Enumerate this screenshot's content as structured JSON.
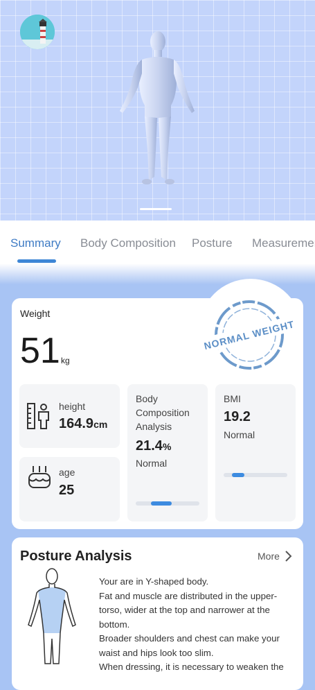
{
  "hero": {
    "avatar_icon": "lighthouse-avatar-icon",
    "model_icon": "3d-body-model"
  },
  "tabs": [
    {
      "label": "Summary",
      "active": true
    },
    {
      "label": "Body Composition",
      "active": false
    },
    {
      "label": "Posture",
      "active": false
    },
    {
      "label": "Measuremen",
      "active": false
    }
  ],
  "summary": {
    "weight_label": "Weight",
    "weight_value": "51",
    "weight_unit": "kg",
    "stamp_text": "NORMAL WEIGHT",
    "height": {
      "label": "height",
      "value": "164.9",
      "unit": "cm",
      "icon": "ruler-person-icon"
    },
    "age": {
      "label": "age",
      "value": "25",
      "icon": "birthday-cake-icon"
    },
    "body_composition": {
      "label_lines": [
        "Body",
        "Composition",
        "Analysis"
      ],
      "value": "21.4",
      "unit": "%",
      "status": "Normal",
      "level": 0.4
    },
    "bmi": {
      "label": "BMI",
      "value": "19.2",
      "status": "Normal",
      "level": 0.23
    }
  },
  "posture": {
    "title": "Posture Analysis",
    "more_label": "More",
    "figure_icon": "y-shaped-body-icon",
    "lines": [
      "Your are in Y-shaped body.",
      "Fat and muscle are distributed in the upper-",
      "torso, wider at the top and narrower at the",
      "bottom.",
      "Broader shoulders and chest can make your",
      "waist and hips look too slim.",
      "When dressing, it is necessary to weaken the"
    ]
  },
  "colors": {
    "accent": "#3e86d6",
    "background": "#a8c4f4",
    "hero": "#c3d4fb"
  }
}
